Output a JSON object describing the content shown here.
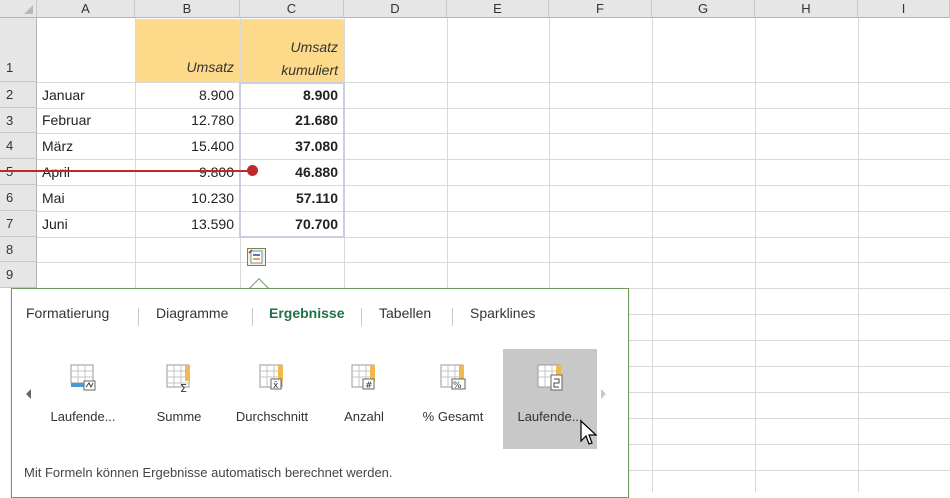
{
  "columns": [
    "A",
    "B",
    "C",
    "D",
    "E",
    "F",
    "G",
    "H",
    "I"
  ],
  "rows": [
    "1",
    "2",
    "3",
    "4",
    "5",
    "6",
    "7",
    "8",
    "9"
  ],
  "header_row": {
    "b": "Umsatz",
    "c_line1": "Umsatz",
    "c_line2": "kumuliert"
  },
  "data": [
    {
      "month": "Januar",
      "umsatz": "8.900",
      "kumuliert": "8.900"
    },
    {
      "month": "Februar",
      "umsatz": "12.780",
      "kumuliert": "21.680"
    },
    {
      "month": "März",
      "umsatz": "15.400",
      "kumuliert": "37.080"
    },
    {
      "month": "April",
      "umsatz": "9.800",
      "kumuliert": "46.880"
    },
    {
      "month": "Mai",
      "umsatz": "10.230",
      "kumuliert": "57.110"
    },
    {
      "month": "Juni",
      "umsatz": "13.590",
      "kumuliert": "70.700"
    }
  ],
  "quick_analysis": {
    "tabs": [
      "Formatierung",
      "Diagramme",
      "Ergebnisse",
      "Tabellen",
      "Sparklines"
    ],
    "active_tab": "Ergebnisse",
    "items": [
      {
        "label": "Laufende...",
        "icon": "running-total-row-icon"
      },
      {
        "label": "Summe",
        "icon": "sum-icon"
      },
      {
        "label": "Durchschnitt",
        "icon": "average-icon"
      },
      {
        "label": "Anzahl",
        "icon": "count-icon"
      },
      {
        "label": "% Gesamt",
        "icon": "percent-total-icon"
      },
      {
        "label": "Laufende...",
        "icon": "running-total-column-icon"
      }
    ],
    "description": "Mit Formeln können Ergebnisse automatisch berechnet werden."
  },
  "colors": {
    "header_fill": "#fdd98a",
    "accent_green": "#217346",
    "callout_red": "#c0282d"
  }
}
